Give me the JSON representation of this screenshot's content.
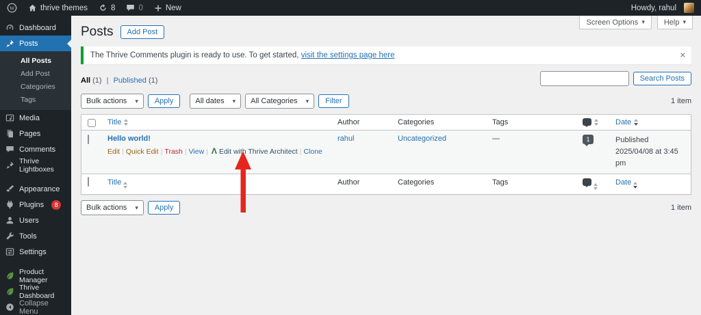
{
  "admin_bar": {
    "site_name": "thrive themes",
    "update_count": "8",
    "comment_count": "0",
    "new_label": "New",
    "howdy": "Howdy, rahul"
  },
  "sidebar": {
    "items": [
      {
        "label": "Dashboard"
      },
      {
        "label": "Posts"
      },
      {
        "label": "Media"
      },
      {
        "label": "Pages"
      },
      {
        "label": "Comments"
      },
      {
        "label": "Thrive Lightboxes"
      },
      {
        "label": "Appearance"
      },
      {
        "label": "Plugins"
      },
      {
        "label": "Users"
      },
      {
        "label": "Tools"
      },
      {
        "label": "Settings"
      },
      {
        "label": "Product Manager"
      },
      {
        "label": "Thrive Dashboard"
      },
      {
        "label": "Collapse Menu"
      }
    ],
    "plugins_badge": "8",
    "posts_submenu": [
      {
        "label": "All Posts"
      },
      {
        "label": "Add Post"
      },
      {
        "label": "Categories"
      },
      {
        "label": "Tags"
      }
    ]
  },
  "header": {
    "title": "Posts",
    "add_post": "Add Post",
    "screen_options": "Screen Options",
    "help": "Help"
  },
  "notice": {
    "text": "The Thrive Comments plugin is ready to use. To get started,",
    "link": "visit the settings page here"
  },
  "filters": {
    "all": "All",
    "all_count": "(1)",
    "published": "Published",
    "published_count": "(1)"
  },
  "toolbar": {
    "bulk_actions": "Bulk actions",
    "apply": "Apply",
    "all_dates": "All dates",
    "all_categories": "All Categories",
    "filter": "Filter",
    "search_button": "Search Posts",
    "item_count": "1 item"
  },
  "table": {
    "columns": {
      "title": "Title",
      "author": "Author",
      "categories": "Categories",
      "tags": "Tags",
      "date": "Date"
    },
    "row": {
      "title": "Hello world!",
      "actions": {
        "edit": "Edit",
        "quick_edit": "Quick Edit",
        "trash": "Trash",
        "view": "View",
        "thrive": "Edit with Thrive Architect",
        "clone": "Clone"
      },
      "author": "rahul",
      "categories": "Uncategorized",
      "tags": "—",
      "comment_count": "1",
      "date_status": "Published",
      "date_value": "2025/04/08 at 3:45 pm"
    }
  },
  "colors": {
    "accent_blue": "#2271b1",
    "admin_dark": "#1d2327",
    "notice_green": "#00a32a",
    "badge_red": "#d63638",
    "trash_red": "#b32d2e",
    "leaf_green": "#5a9442",
    "arrow_red": "#e5261f"
  }
}
